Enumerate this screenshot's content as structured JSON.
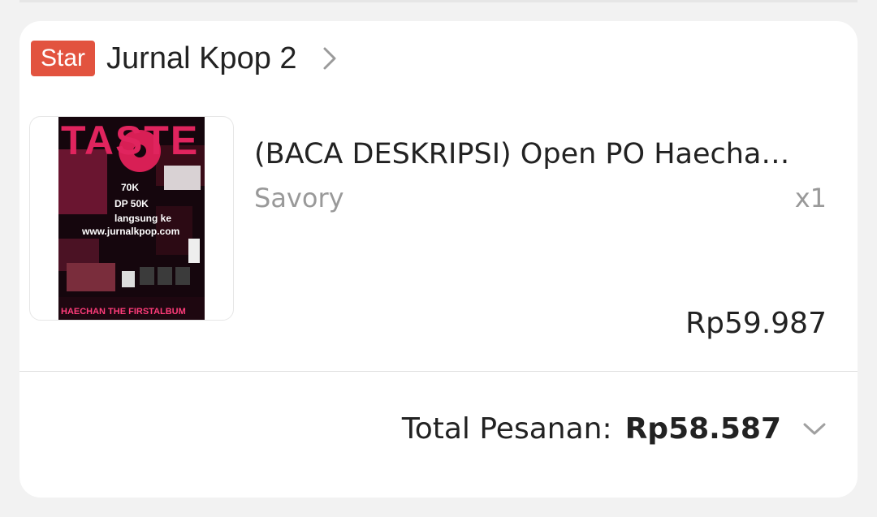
{
  "shop": {
    "badge": "Star",
    "name": "Jurnal Kpop 2"
  },
  "product": {
    "title": "(BACA DESKRIPSI) Open PO Haecha…",
    "variant": "Savory",
    "quantity": "x1",
    "price": "Rp59.987",
    "image": {
      "heading": "TASTE",
      "lines": [
        "70K",
        "DP 50K",
        "langsung ke",
        "www.jurnalkpop.com"
      ],
      "footer": "HAECHAN   THE FIRSTALBUM"
    }
  },
  "order": {
    "total_label": "Total Pesanan:",
    "total_value": "Rp58.587"
  },
  "icons": {
    "shop_chevron": "chevron-right-icon",
    "expand": "chevron-down-icon"
  },
  "colors": {
    "badge_bg": "#e2533f",
    "poster_accent": "#e0245e"
  }
}
